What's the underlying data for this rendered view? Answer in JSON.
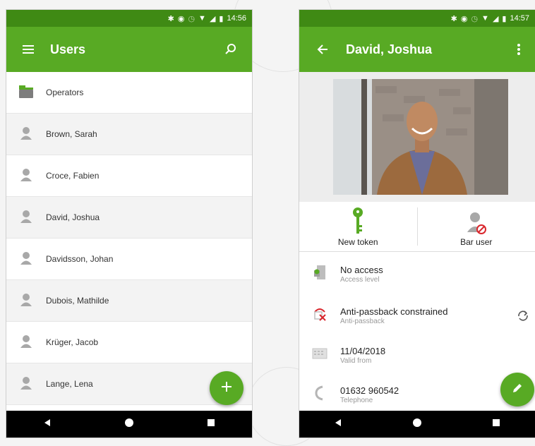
{
  "colors": {
    "primary": "#58aa24",
    "status_bar": "#3f8a14",
    "nav_bar": "#000000",
    "delete_red": "#d9262c"
  },
  "left": {
    "status": {
      "time": "14:56"
    },
    "appbar": {
      "title": "Users",
      "menu_icon": "hamburger-icon",
      "search_icon": "search-icon"
    },
    "items": [
      {
        "label": "Operators",
        "icon": "folder-icon"
      },
      {
        "label": "Brown, Sarah",
        "icon": "user-icon"
      },
      {
        "label": "Croce, Fabien",
        "icon": "user-icon"
      },
      {
        "label": "David, Joshua",
        "icon": "user-icon"
      },
      {
        "label": "Davidsson, Johan",
        "icon": "user-icon"
      },
      {
        "label": "Dubois, Mathilde",
        "icon": "user-icon"
      },
      {
        "label": "Krüger, Jacob",
        "icon": "user-icon"
      },
      {
        "label": "Lange, Lena",
        "icon": "user-icon"
      }
    ],
    "fab_icon": "plus-icon"
  },
  "right": {
    "status": {
      "time": "14:57"
    },
    "appbar": {
      "title": "David, Joshua",
      "back_icon": "back-arrow-icon",
      "more_icon": "more-vert-icon"
    },
    "actions": [
      {
        "label": "New token",
        "icon": "key-icon"
      },
      {
        "label": "Bar user",
        "icon": "bar-user-icon"
      }
    ],
    "details": [
      {
        "value": "No access",
        "label": "Access level",
        "icon": "door-icon"
      },
      {
        "value": "Anti-passback constrained",
        "label": "Anti-passback",
        "icon": "antipassback-icon",
        "action_icon": "sync-icon"
      },
      {
        "value": "11/04/2018",
        "label": "Valid from",
        "icon": "calendar-icon"
      },
      {
        "value": "01632 960542",
        "label": "Telephone",
        "icon": "phone-icon"
      }
    ],
    "fab_icon": "edit-icon"
  }
}
